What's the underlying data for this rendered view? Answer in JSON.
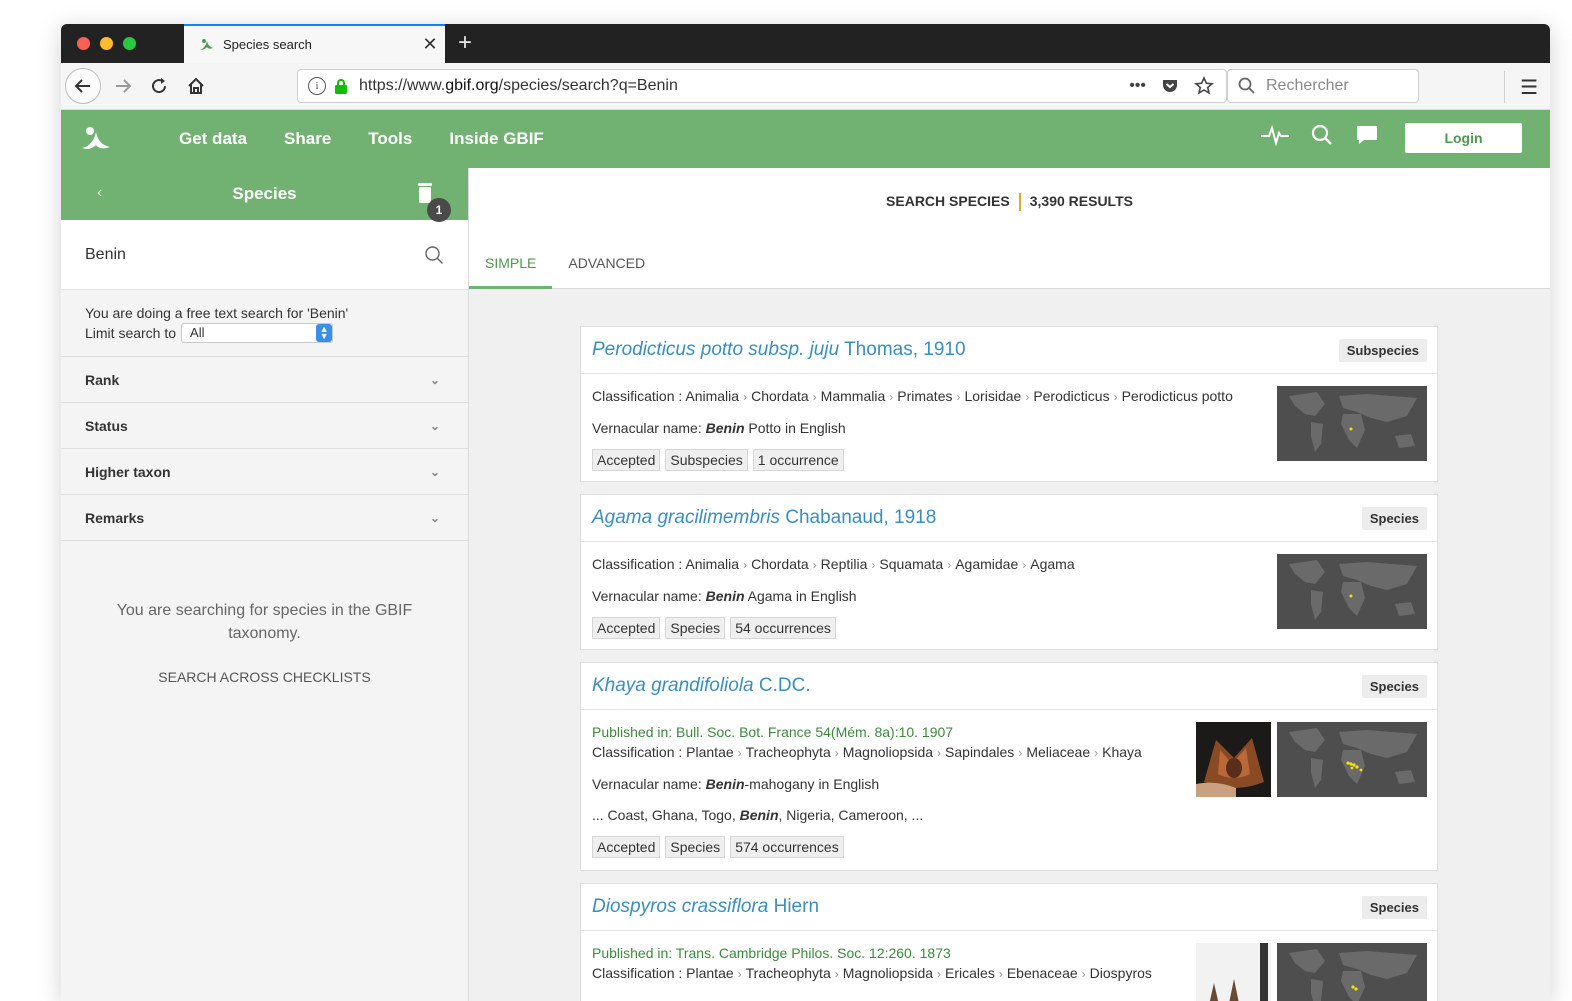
{
  "browser": {
    "tab_title": "Species search",
    "url_prefix": "https://www.",
    "url_host": "gbif.org",
    "url_path": "/species/search?q=Benin",
    "search_placeholder": "Rechercher",
    "ellipsis": "•••"
  },
  "gbif": {
    "nav": [
      "Get data",
      "Share",
      "Tools",
      "Inside GBIF"
    ],
    "login": "Login"
  },
  "sidebar": {
    "title": "Species",
    "badge_count": "1",
    "search_value": "Benin",
    "free_text_msg": "You are doing a free text search for 'Benin'",
    "limit_label": "Limit search to",
    "limit_value": "All",
    "facets": [
      "Rank",
      "Status",
      "Higher taxon",
      "Remarks"
    ],
    "info_text": "You are searching for species in the GBIF taxonomy.",
    "across_link": "SEARCH ACROSS CHECKLISTS"
  },
  "results_header": {
    "label": "SEARCH SPECIES",
    "count": "3,390 RESULTS",
    "tabs": [
      "SIMPLE",
      "ADVANCED"
    ]
  },
  "results": [
    {
      "name": "Perodicticus potto subsp. juju",
      "author": " Thomas, 1910",
      "rank": "Subspecies",
      "classification_label": "Classification : ",
      "classification": [
        "Animalia",
        "Chordata",
        "Mammalia",
        "Primates",
        "Lorisidae",
        "Perodicticus",
        "Perodicticus potto"
      ],
      "vernacular_label": "Vernacular name: ",
      "vernacular_bold": "Benin",
      "vernacular_rest": " Potto in English",
      "tags": [
        "Accepted",
        "Subspecies",
        "1 occurrence"
      ]
    },
    {
      "name": "Agama gracilimembris",
      "author": " Chabanaud, 1918",
      "rank": "Species",
      "classification_label": "Classification : ",
      "classification": [
        "Animalia",
        "Chordata",
        "Reptilia",
        "Squamata",
        "Agamidae",
        "Agama"
      ],
      "vernacular_label": "Vernacular name: ",
      "vernacular_bold": "Benin",
      "vernacular_rest": " Agama in English",
      "tags": [
        "Accepted",
        "Species",
        "54 occurrences"
      ]
    },
    {
      "name": "Khaya grandifoliola",
      "author": " C.DC.",
      "rank": "Species",
      "published": "Published in: Bull. Soc. Bot. France 54(Mém. 8a):10. 1907",
      "classification_label": "Classification : ",
      "classification": [
        "Plantae",
        "Tracheophyta",
        "Magnoliopsida",
        "Sapindales",
        "Meliaceae",
        "Khaya"
      ],
      "vernacular_label": "Vernacular name: ",
      "vernacular_bold": "Benin",
      "vernacular_rest": "-mahogany in English",
      "snippet_pre": "... Coast, Ghana, Togo, ",
      "snippet_bold": "Benin",
      "snippet_post": ", Nigeria, Cameroon, ...",
      "tags": [
        "Accepted",
        "Species",
        "574 occurrences"
      ]
    },
    {
      "name": "Diospyros crassiflora",
      "author": " Hiern",
      "rank": "Species",
      "published": "Published in: Trans. Cambridge Philos. Soc. 12:260. 1873",
      "classification_label": "Classification : ",
      "classification": [
        "Plantae",
        "Tracheophyta",
        "Magnoliopsida",
        "Ericales",
        "Ebenaceae",
        "Diospyros"
      ]
    }
  ],
  "colors": {
    "gbif_green": "#71b171",
    "link_blue": "#3a8ebf",
    "published_green": "#3d8a3d",
    "separator_amber": "#e0a82e"
  }
}
